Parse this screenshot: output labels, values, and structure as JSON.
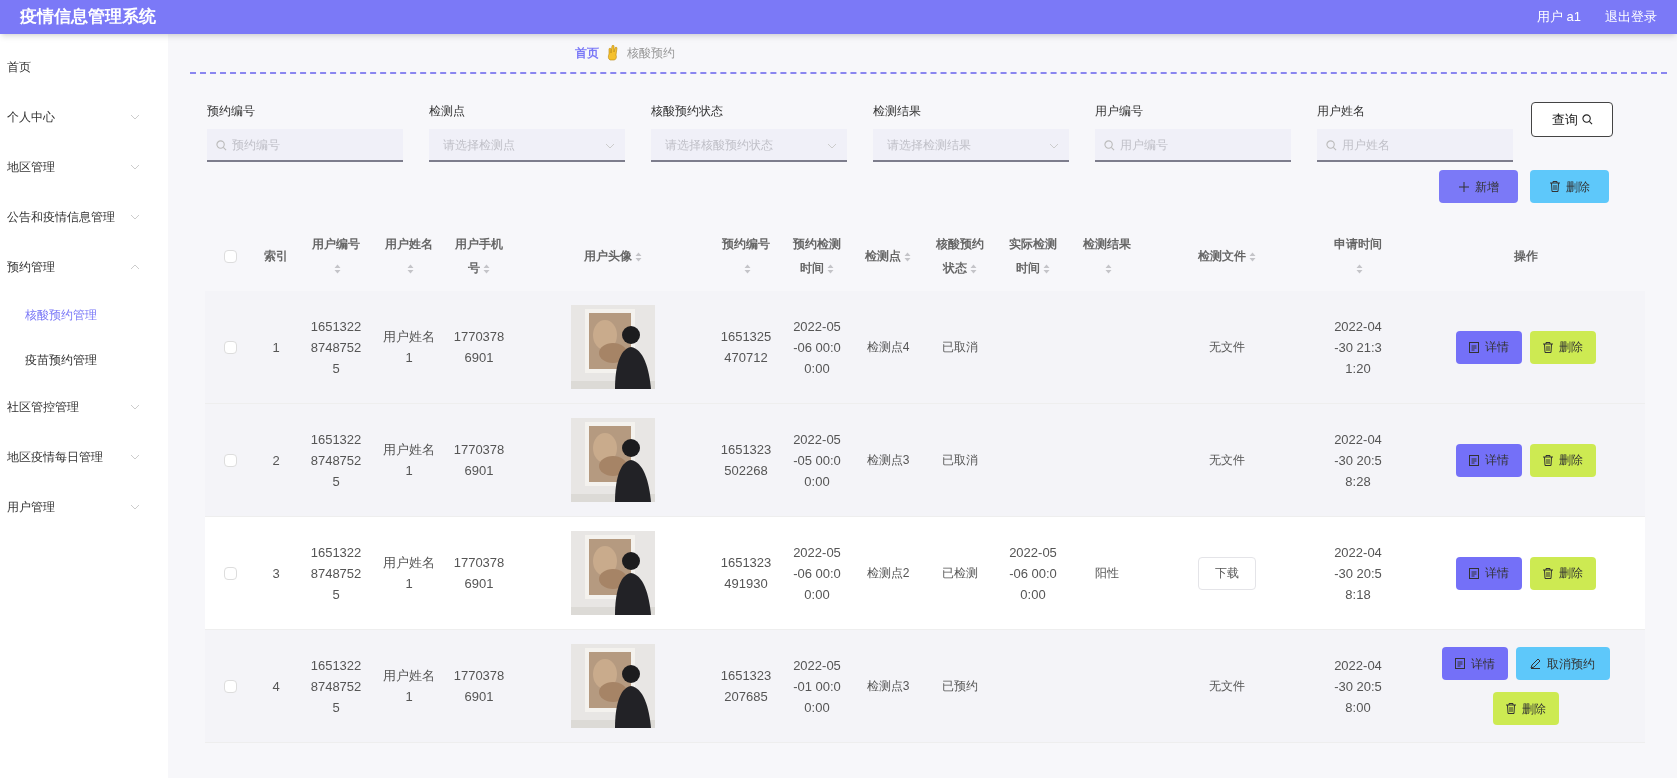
{
  "header": {
    "title": "疫情信息管理系统",
    "user": "用户 a1",
    "logout": "退出登录"
  },
  "sidebar": {
    "items": [
      {
        "label": "首页",
        "selected": false
      },
      {
        "label": "个人中心",
        "expanded": false,
        "selected": false
      },
      {
        "label": "地区管理",
        "expanded": false,
        "selected": false
      },
      {
        "label": "公告和疫情信息管理",
        "expanded": false,
        "selected": false
      },
      {
        "label": "预约管理",
        "expanded": true,
        "selected": false,
        "children": [
          {
            "label": "核酸预约管理",
            "selected": true
          },
          {
            "label": "疫苗预约管理",
            "selected": false
          }
        ]
      },
      {
        "label": "社区管控管理",
        "expanded": false,
        "selected": false
      },
      {
        "label": "地区疫情每日管理",
        "expanded": false,
        "selected": false
      },
      {
        "label": "用户管理",
        "expanded": false,
        "selected": false
      }
    ]
  },
  "breadcrumb": [
    "首页",
    "核酸预约"
  ],
  "filters": [
    {
      "kind": "input",
      "label": "预约编号",
      "placeholder": "预约编号"
    },
    {
      "kind": "select",
      "label": "检测点",
      "placeholder": "请选择检测点"
    },
    {
      "kind": "select",
      "label": "核酸预约状态",
      "placeholder": "请选择核酸预约状态"
    },
    {
      "kind": "select",
      "label": "检测结果",
      "placeholder": "请选择检测结果"
    },
    {
      "kind": "input",
      "label": "用户编号",
      "placeholder": "用户编号"
    },
    {
      "kind": "input",
      "label": "用户姓名",
      "placeholder": "用户姓名"
    }
  ],
  "query_button": "查询",
  "toolbar": [
    {
      "kind": "add",
      "label": "新增"
    },
    {
      "kind": "delete",
      "label": "删除"
    }
  ],
  "table": {
    "select_all_checked": false,
    "columns": [
      {
        "label": "索引",
        "sortable": false
      },
      {
        "label": "用户编号",
        "sortable": true
      },
      {
        "label": "用户姓名",
        "sortable": true
      },
      {
        "label": "用户手机号",
        "sortable": true
      },
      {
        "label": "用户头像",
        "sortable": true
      },
      {
        "label": "预约编号",
        "sortable": true
      },
      {
        "label": "预约检测时间",
        "sortable": true
      },
      {
        "label": "检测点",
        "sortable": true
      },
      {
        "label": "核酸预约状态",
        "sortable": true
      },
      {
        "label": "实际检测时间",
        "sortable": true
      },
      {
        "label": "检测结果",
        "sortable": true
      },
      {
        "label": "检测文件",
        "sortable": true
      },
      {
        "label": "申请时间",
        "sortable": true
      },
      {
        "label": "操作",
        "sortable": false
      }
    ],
    "rows": [
      {
        "checked": false,
        "index": "1",
        "user_id": "165132287487525",
        "user_name": "用户姓名1",
        "phone": "17703786901",
        "avatar": {
          "kind": "picture"
        },
        "booking_no": "1651325470712",
        "booking_time": "2022-05-06 00:00:00",
        "site": "检测点4",
        "status": "已取消",
        "file": {
          "kind": "text",
          "label": "无文件"
        },
        "applied": "2022-04-30 21:31:20",
        "actions": [
          {
            "kind": "detail",
            "label": "详情"
          },
          {
            "kind": "delete",
            "label": "删除"
          }
        ]
      },
      {
        "checked": false,
        "index": "2",
        "user_id": "165132287487525",
        "user_name": "用户姓名1",
        "phone": "17703786901",
        "avatar": {
          "kind": "picture"
        },
        "booking_no": "1651323502268",
        "booking_time": "2022-05-05 00:00:00",
        "site": "检测点3",
        "status": "已取消",
        "file": {
          "kind": "text",
          "label": "无文件"
        },
        "applied": "2022-04-30 20:58:28",
        "actions": [
          {
            "kind": "detail",
            "label": "详情"
          },
          {
            "kind": "delete",
            "label": "删除"
          }
        ]
      },
      {
        "checked": false,
        "index": "3",
        "user_id": "165132287487525",
        "user_name": "用户姓名1",
        "phone": "17703786901",
        "avatar": {
          "kind": "picture"
        },
        "booking_no": "1651323491930",
        "booking_time": "2022-05-06 00:00:00",
        "site": "检测点2",
        "status": "已检测",
        "actual_time": "2022-05-06 00:00:00",
        "result": "阳性",
        "file": {
          "kind": "button",
          "label": "下载"
        },
        "applied": "2022-04-30 20:58:18",
        "actions": [
          {
            "kind": "detail",
            "label": "详情"
          },
          {
            "kind": "delete",
            "label": "删除"
          }
        ]
      },
      {
        "checked": false,
        "index": "4",
        "user_id": "165132287487525",
        "user_name": "用户姓名1",
        "phone": "17703786901",
        "avatar": {
          "kind": "picture"
        },
        "booking_no": "1651323207685",
        "booking_time": "2022-05-01 00:00:00",
        "site": "检测点3",
        "status": "已预约",
        "file": {
          "kind": "text",
          "label": "无文件"
        },
        "applied": "2022-04-30 20:58:00",
        "actions": [
          {
            "kind": "detail",
            "label": "详情"
          },
          {
            "kind": "cancel",
            "label": "取消预约"
          },
          {
            "kind": "delete",
            "label": "删除"
          }
        ]
      }
    ]
  }
}
